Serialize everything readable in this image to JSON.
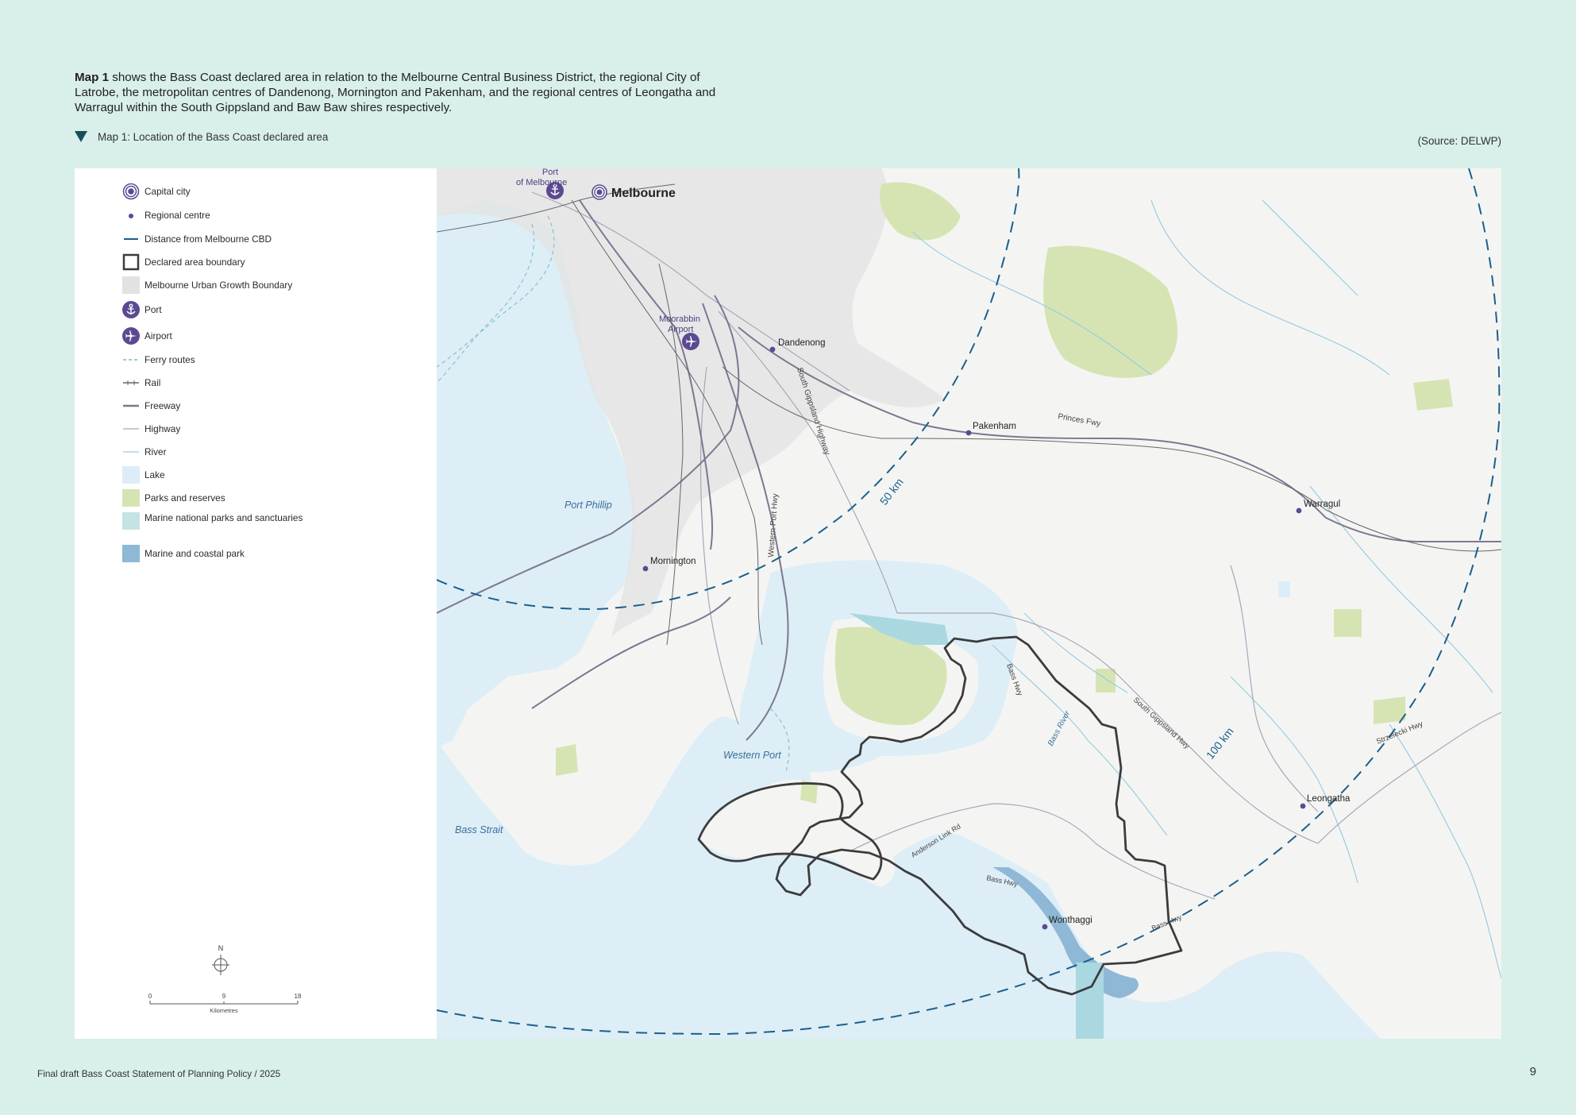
{
  "intro": {
    "bold": "Map 1",
    "text": " shows the Bass Coast declared area in relation to the Melbourne Central Business District, the regional City of Latrobe, the metropolitan centres of Dandenong, Mornington and Pakenham, and the regional centres of Leongatha and Warragul within the South Gippsland and Baw Baw shires respectively."
  },
  "caption": {
    "title": "Map 1: Location of the Bass Coast declared area",
    "source": "(Source: DELWP)"
  },
  "legend": [
    {
      "label": "Capital city",
      "icon": "capital-city-icon"
    },
    {
      "label": "Regional centre",
      "icon": "regional-centre-icon"
    },
    {
      "label": "Distance from Melbourne CBD",
      "icon": "distance-line-icon"
    },
    {
      "label": "Declared area boundary",
      "icon": "boundary-box-icon"
    },
    {
      "label": "Melbourne Urban Growth Boundary",
      "icon": "urban-growth-swatch"
    },
    {
      "label": "Port",
      "icon": "anchor-icon"
    },
    {
      "label": "Airport",
      "icon": "airplane-icon"
    },
    {
      "label": "Ferry routes",
      "icon": "ferry-route-icon"
    },
    {
      "label": "Rail",
      "icon": "rail-icon"
    },
    {
      "label": "Freeway",
      "icon": "freeway-icon"
    },
    {
      "label": "Highway",
      "icon": "highway-icon"
    },
    {
      "label": "River",
      "icon": "river-icon"
    },
    {
      "label": "Lake",
      "icon": "lake-swatch"
    },
    {
      "label": "Parks and reserves",
      "icon": "parks-swatch"
    },
    {
      "label": "Marine national parks and sanctuaries",
      "icon": "marine-np-swatch"
    },
    {
      "label": "Marine and coastal park",
      "icon": "marine-coastal-swatch"
    }
  ],
  "legend_colors": {
    "purple": "#5b4a91",
    "distance": "#1b5f8c",
    "urban": "#e2e2e2",
    "lake": "#dcedf7",
    "parks": "#d6e4b4",
    "marine_np": "#c4e3e3",
    "marine_coastal": "#8eb8d5"
  },
  "map": {
    "places": {
      "melbourne": "Melbourne",
      "port_of_melbourne": "Port\nof Melbourne",
      "moorabbin_airport": "Moorabbin\nAirport",
      "dandenong": "Dandenong",
      "pakenham": "Pakenham",
      "warragul": "Warragul",
      "mornington": "Mornington",
      "leongatha": "Leongatha",
      "wonthaggi": "Wonthaggi"
    },
    "water": {
      "port_phillip": "Port Phillip",
      "western_port": "Western Port",
      "bass_strait": "Bass Strait",
      "bass_river": "Bass River"
    },
    "roads": {
      "princes_fwy": "Princes Fwy",
      "south_gippsland_highway": "South Gippsland Highway",
      "western_port_hwy": "Western Port Hwy",
      "bass_hwy_north": "Bass Hwy",
      "south_gippsland_hwy": "South Gippsland Hwy",
      "strzelecki_hwy": "Strzelecki Hwy",
      "anderson_link_rd": "Anderson Link Rd",
      "bass_hwy_mid": "Bass Hwy",
      "bass_hwy_south": "Bass Hwy"
    },
    "distances": {
      "ring_50": "50 km",
      "ring_100": "100 km"
    }
  },
  "north_arrow": {
    "label": "N"
  },
  "scale": {
    "ticks": [
      "0",
      "9",
      "18"
    ],
    "unit": "Kilometres"
  },
  "footer": {
    "document": "Final draft Bass Coast Statement of Planning Policy  /  2025",
    "page": "9"
  }
}
